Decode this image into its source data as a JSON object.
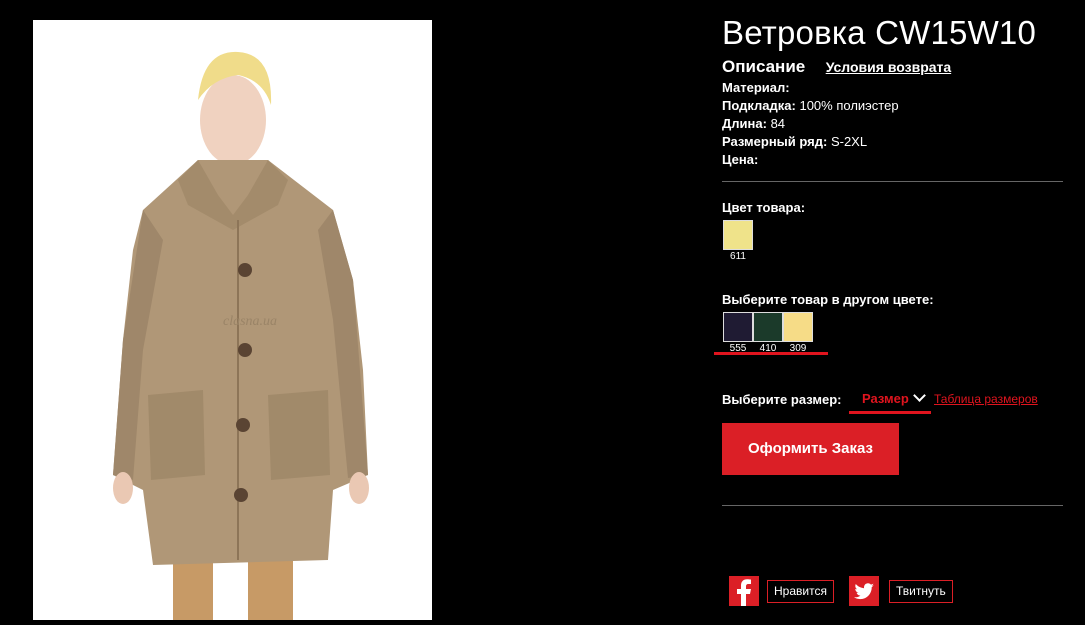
{
  "product": {
    "title": "Ветровка CW15W10",
    "watermark": "clasna.ua"
  },
  "tabs": {
    "description": "Описание",
    "returns": "Условия возврата"
  },
  "properties": [
    {
      "label": "Материал:",
      "value": ""
    },
    {
      "label": "Подкладка:",
      "value": "100% полиэстер"
    },
    {
      "label": "Длина:",
      "value": "84"
    },
    {
      "label": "Размерный ряд:",
      "value": "S-2XL"
    },
    {
      "label": "Цена:",
      "value": ""
    }
  ],
  "color_section": {
    "label": "Цвет товара:",
    "current": {
      "code": "611",
      "color": "#efe38a"
    }
  },
  "other_colors": {
    "label": "Выберите товар в другом цвете:",
    "items": [
      {
        "code": "555",
        "color": "#1f1b33"
      },
      {
        "code": "410",
        "color": "#1b3a2a"
      },
      {
        "code": "309",
        "color": "#f6dc87"
      }
    ]
  },
  "size": {
    "label": "Выберите размер:",
    "select_value": "Размер",
    "table_link": "Таблица размеров"
  },
  "order_button": "Оформить Заказ",
  "social": {
    "like": "Нравится",
    "tweet": "Твитнуть"
  },
  "colors": {
    "accent": "#e0141e",
    "background": "#000000"
  }
}
